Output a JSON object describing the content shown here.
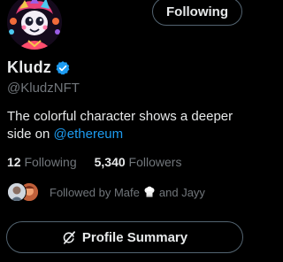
{
  "profile": {
    "name": "Kludz",
    "handle": "@KludzNFT",
    "bio_text": "The colorful character shows a deeper side on ",
    "bio_mention": "@ethereum",
    "avatar_icon": "cartoon-character-avatar",
    "verified_icon": "verified-badge-icon"
  },
  "actions": {
    "follow_label": "Following",
    "summary_label": "Profile Summary",
    "summary_icon": "grok-icon"
  },
  "stats": {
    "following_count": "12",
    "following_label": "Following",
    "followers_count": "5,340",
    "followers_label": "Followers"
  },
  "followed_by": {
    "prefix": "Followed by Mafe",
    "emoji_icon": "chef-hat-icon",
    "suffix": "and Jayy"
  },
  "colors": {
    "background": "#000000",
    "text_primary": "#e7e9ea",
    "text_secondary": "#71767b",
    "accent": "#1d9bf0",
    "border": "#536471"
  }
}
